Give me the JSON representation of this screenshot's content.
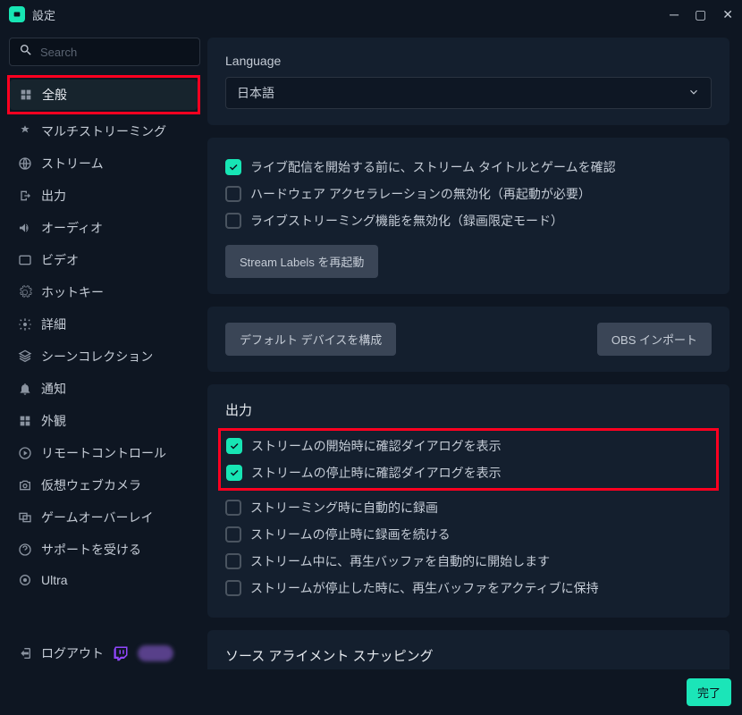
{
  "window": {
    "title": "設定"
  },
  "search": {
    "placeholder": "Search"
  },
  "nav": {
    "items": [
      {
        "label": "全般"
      },
      {
        "label": "マルチストリーミング"
      },
      {
        "label": "ストリーム"
      },
      {
        "label": "出力"
      },
      {
        "label": "オーディオ"
      },
      {
        "label": "ビデオ"
      },
      {
        "label": "ホットキー"
      },
      {
        "label": "詳細"
      },
      {
        "label": "シーンコレクション"
      },
      {
        "label": "通知"
      },
      {
        "label": "外観"
      },
      {
        "label": "リモートコントロール"
      },
      {
        "label": "仮想ウェブカメラ"
      },
      {
        "label": "ゲームオーバーレイ"
      },
      {
        "label": "サポートを受ける"
      },
      {
        "label": "Ultra"
      }
    ]
  },
  "language": {
    "label": "Language",
    "value": "日本語"
  },
  "general_checks": {
    "c1": "ライブ配信を開始する前に、ストリーム タイトルとゲームを確認",
    "c2": "ハードウェア アクセラレーションの無効化（再起動が必要）",
    "c3": "ライブストリーミング機能を無効化（録画限定モード）",
    "restart_btn": "Stream Labels を再起動"
  },
  "device_row": {
    "configure": "デフォルト デバイスを構成",
    "import": "OBS インポート"
  },
  "output": {
    "title": "出力",
    "o1": "ストリームの開始時に確認ダイアログを表示",
    "o2": "ストリームの停止時に確認ダイアログを表示",
    "o3": "ストリーミング時に自動的に録画",
    "o4": "ストリームの停止時に録画を続ける",
    "o5": "ストリーム中に、再生バッファを自動的に開始します",
    "o6": "ストリームが停止した時に、再生バッファをアクティブに保持"
  },
  "snapping": {
    "title": "ソース アライメント スナッピング"
  },
  "footer": {
    "logout": "ログアウト"
  },
  "done": "完了"
}
